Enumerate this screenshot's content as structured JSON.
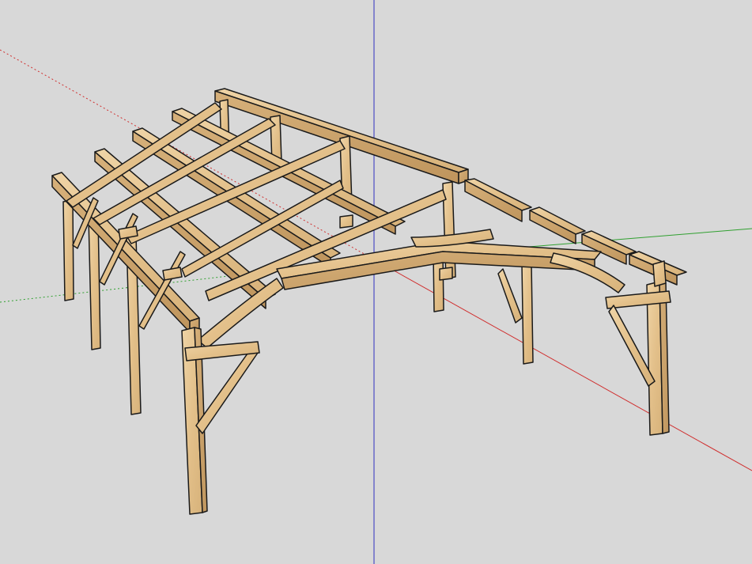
{
  "viewport": {
    "background": "#d8d8d8"
  },
  "axes": {
    "red_axis_color": "#d03030",
    "green_axis_color": "#30a030",
    "blue_axis_color": "#3030c0"
  },
  "model": {
    "timber_color": "#e7c795",
    "timber_shade_color": "#c9a46a",
    "edge_color": "#1a1a1a",
    "edge_icon": "timber-frame-structure"
  }
}
